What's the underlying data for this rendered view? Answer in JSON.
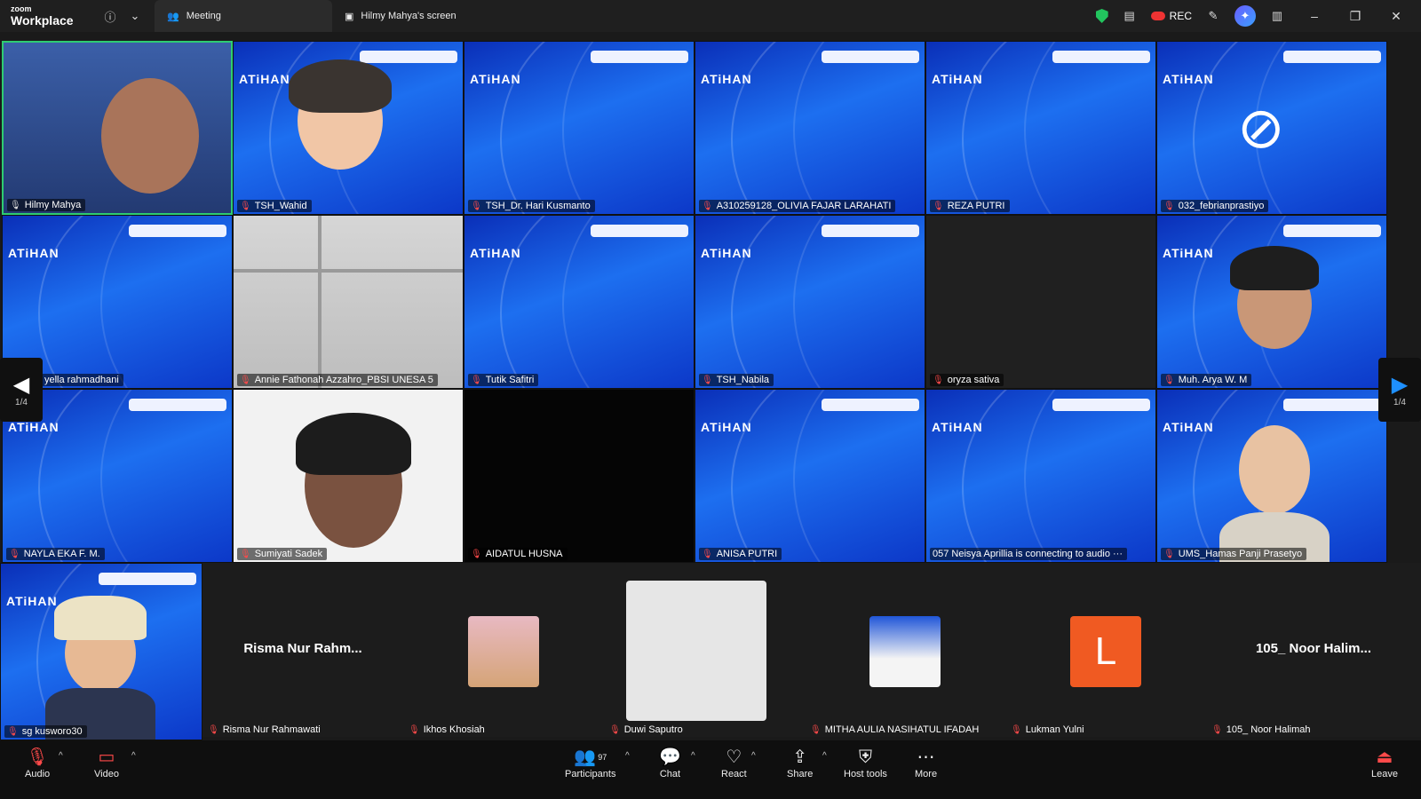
{
  "app": {
    "brand_small": "zoom",
    "brand_big": "Workplace"
  },
  "tabs": [
    {
      "label": "Meeting",
      "icon": "people-icon"
    },
    {
      "label": "Hilmy Mahya's screen",
      "icon": "screen-share-icon"
    }
  ],
  "titlebar": {
    "rec_label": "REC"
  },
  "tiles": [
    {
      "name": "Hilmy Mahya",
      "muted": false
    },
    {
      "name": "TSH_Wahid",
      "muted": true
    },
    {
      "name": "TSH_Dr. Hari Kusmanto",
      "muted": true
    },
    {
      "name": "A310259128_OLIVIA FAJAR LARAHATI",
      "muted": true
    },
    {
      "name": "REZA PUTRI",
      "muted": true
    },
    {
      "name": "032_febrianprastiyo",
      "muted": true
    },
    {
      "name": "yella rahmadhani",
      "muted": true
    },
    {
      "name": "Annie Fathonah Azzahro_PBSI UNESA 5",
      "muted": true
    },
    {
      "name": "Tutik Safitri",
      "muted": true
    },
    {
      "name": "TSH_Nabila",
      "muted": true
    },
    {
      "name": "oryza sativa",
      "muted": true
    },
    {
      "name": "Muh. Arya W. M",
      "muted": true
    },
    {
      "name": "NAYLA EKA F. M.",
      "muted": true
    },
    {
      "name": "Sumiyati Sadek",
      "muted": true
    },
    {
      "name": "AIDATUL HUSNA",
      "muted": true
    },
    {
      "name": "ANISA PUTRI",
      "muted": true
    },
    {
      "name": "057 Neisya Aprillia is connecting to audio ···",
      "muted": false
    },
    {
      "name": "UMS_Hamas Panji Prasetyo",
      "muted": true
    }
  ],
  "slide_heading": "ATiHAN",
  "bottom_row": [
    {
      "name": "sg kusworo30",
      "big": ""
    },
    {
      "name": "Risma Nur Rahmawati",
      "big": "Risma  Nur  Rahm..."
    },
    {
      "name": "Ikhos Khosiah",
      "big": ""
    },
    {
      "name": "Duwi Saputro",
      "big": ""
    },
    {
      "name": "MITHA AULIA NASIHATUL IFADAH",
      "big": ""
    },
    {
      "name": "Lukman Yulni",
      "big": "",
      "initial": "L"
    },
    {
      "name": "105_ Noor Halimah",
      "big": "105_  Noor  Halim..."
    }
  ],
  "pager": {
    "left": "1/4",
    "right": "1/4"
  },
  "toolbar": {
    "audio": "Audio",
    "video": "Video",
    "participants": "Participants",
    "participants_count": "97",
    "chat": "Chat",
    "react": "React",
    "share": "Share",
    "host_tools": "Host tools",
    "more": "More",
    "leave": "Leave"
  }
}
